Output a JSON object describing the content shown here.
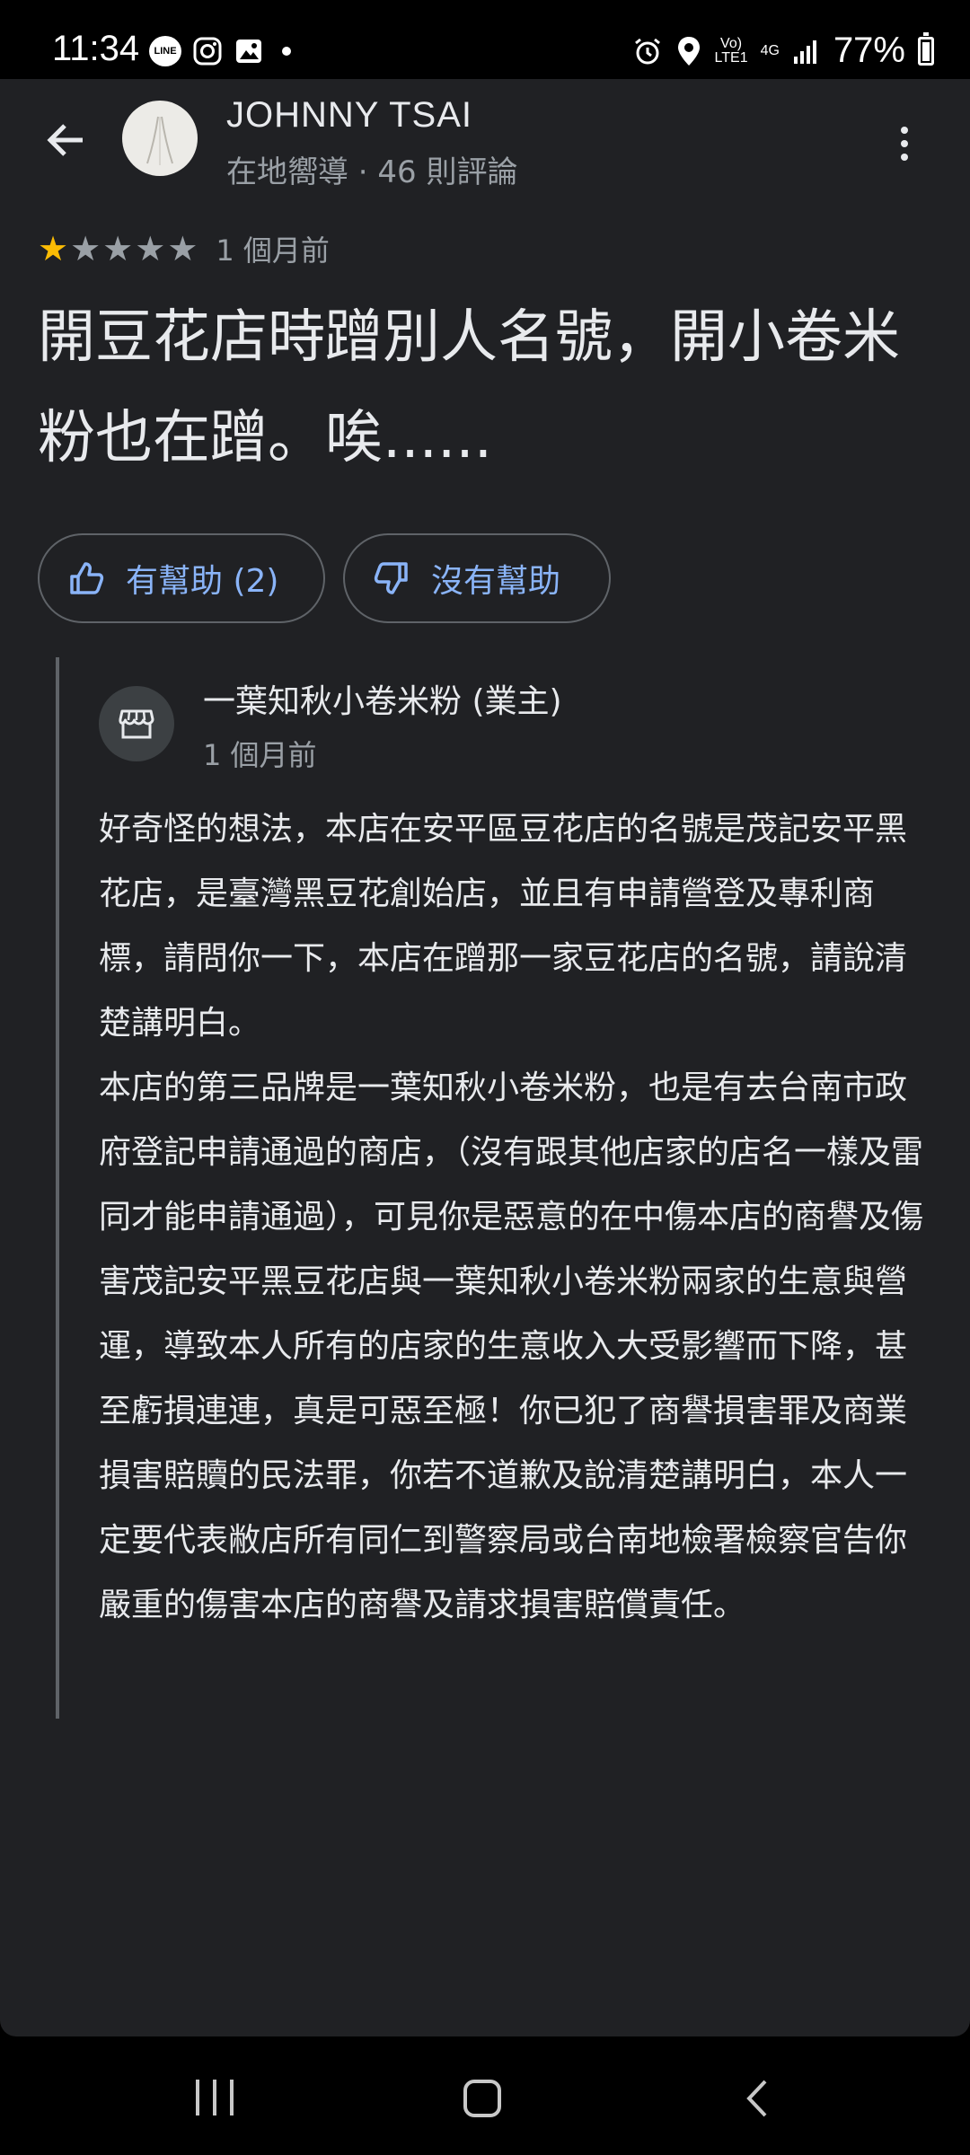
{
  "status_bar": {
    "time": "11:34",
    "line_icon_text": "LINE",
    "network_top": "Vo)",
    "network_bottom": "LTE1",
    "network_type": "4G",
    "battery": "77%",
    "battery_level": 0.77,
    "icons": [
      "line-icon",
      "instagram-icon",
      "gallery-icon",
      "dot-icon",
      "alarm-icon",
      "location-icon",
      "signal-icon",
      "battery-icon"
    ]
  },
  "review": {
    "author": "JOHNNY TSAI",
    "author_meta": "在地嚮導 · 46 則評論",
    "rating": 1,
    "rating_max": 5,
    "date": "1 個月前",
    "text": "開豆花店時蹭別人名號，開小卷米粉也在蹭。唉......",
    "helpful_label": "有幫助 (2)",
    "not_helpful_label": "沒有幫助"
  },
  "owner_response": {
    "owner_name": "一葉知秋小卷米粉 (業主)",
    "date": "1 個月前",
    "paragraphs": [
      "好奇怪的想法，本店在安平區豆花店的名號是茂記安平黑花店，是臺灣黑豆花創始店，並且有申請營登及專利商標，請問你一下，本店在蹭那一家豆花店的名號，請說清楚講明白。",
      "本店的第三品牌是一葉知秋小卷米粉，也是有去台南市政府登記申請通過的商店，（沒有跟其他店家的店名一樣及雷同才能申請通過），可見你是惡意的在中傷本店的商譽及傷害茂記安平黑豆花店與一葉知秋小卷米粉兩家的生意與營運，導致本人所有的店家的生意收入大受影響而下降，甚至虧損連連，真是可惡至極！你已犯了商譽損害罪及商業損害賠贖的民法罪，你若不道歉及說清楚講明白，本人一定要代表敝店所有同仁到警察局或台南地檢署檢察官告你嚴重的傷害本店的商譽及請求損害賠償責任。"
    ]
  },
  "colors": {
    "background": "#202124",
    "text": "#e8eaed",
    "secondary": "#9aa0a6",
    "accent": "#8ab4f8",
    "star": "#fbbc04"
  }
}
